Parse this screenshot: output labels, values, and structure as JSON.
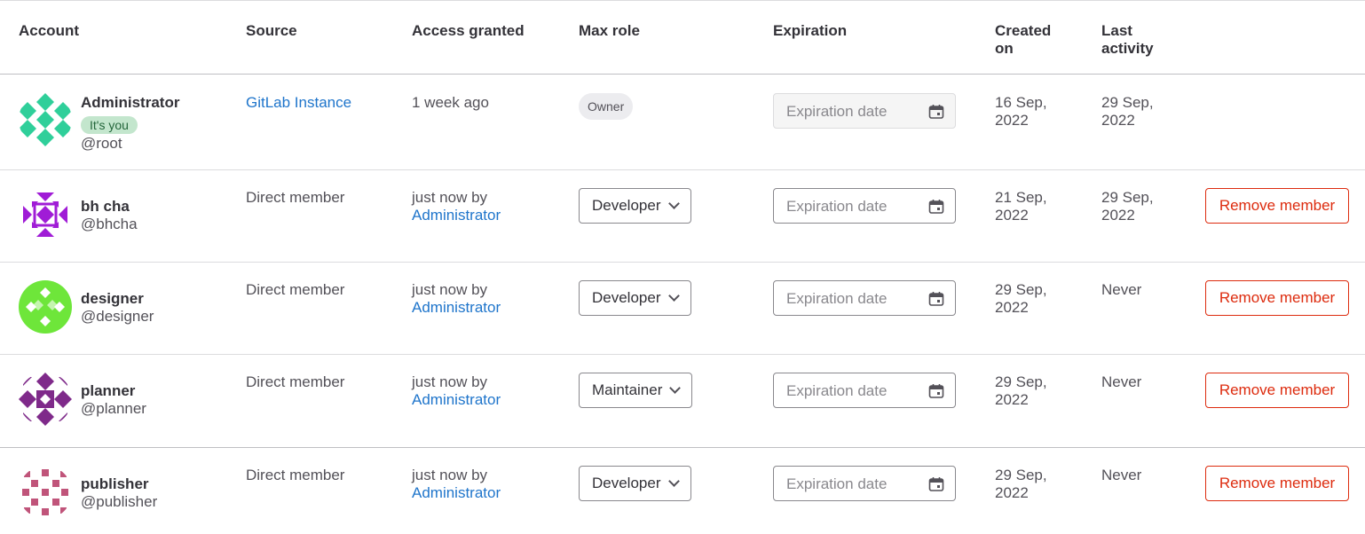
{
  "headers": {
    "account": "Account",
    "source": "Source",
    "access_granted": "Access granted",
    "max_role": "Max role",
    "expiration": "Expiration",
    "created_on_1": "Created",
    "created_on_2": "on",
    "last_activity_1": "Last",
    "last_activity_2": "activity"
  },
  "members": [
    {
      "name": "Administrator",
      "username": "@root",
      "badge": "It's you",
      "source": "GitLab Instance",
      "access_text": "1 week ago",
      "access_by": "",
      "role": "Owner",
      "expiration_placeholder": "Expiration date",
      "created_1": "16 Sep,",
      "created_2": "2022",
      "activity_1": "29 Sep,",
      "activity_2": "2022",
      "avatar_color": "#2fcf9a",
      "remove_label": ""
    },
    {
      "name": "bh cha",
      "username": "@bhcha",
      "source": "Direct member",
      "access_text": "just now by",
      "access_by": "Administrator",
      "role": "Developer",
      "expiration_placeholder": "Expiration date",
      "created_1": "21 Sep,",
      "created_2": "2022",
      "activity_1": "29 Sep,",
      "activity_2": "2022",
      "avatar_color": "#a01cd6",
      "remove_label": "Remove member"
    },
    {
      "name": "designer",
      "username": "@designer",
      "source": "Direct member",
      "access_text": "just now by",
      "access_by": "Administrator",
      "role": "Developer",
      "expiration_placeholder": "Expiration date",
      "created_1": "29 Sep,",
      "created_2": "2022",
      "activity_1": "Never",
      "activity_2": "",
      "avatar_color": "#6ee63a",
      "remove_label": "Remove member"
    },
    {
      "name": "planner",
      "username": "@planner",
      "source": "Direct member",
      "access_text": "just now by",
      "access_by": "Administrator",
      "role": "Maintainer",
      "expiration_placeholder": "Expiration date",
      "created_1": "29 Sep,",
      "created_2": "2022",
      "activity_1": "Never",
      "activity_2": "",
      "avatar_color": "#7f2a8a",
      "remove_label": "Remove member"
    },
    {
      "name": "publisher",
      "username": "@publisher",
      "source": "Direct member",
      "access_text": "just now by",
      "access_by": "Administrator",
      "role": "Developer",
      "expiration_placeholder": "Expiration date",
      "created_1": "29 Sep,",
      "created_2": "2022",
      "activity_1": "Never",
      "activity_2": "",
      "avatar_color": "#c0547a",
      "remove_label": "Remove member"
    }
  ],
  "icons": {
    "calendar": "calendar-icon",
    "chevron": "chevron-down-icon",
    "avatar": "identicon-avatar"
  },
  "colors": {
    "link": "#1f75cb",
    "danger": "#dd2b0e",
    "badge_bg": "#c3e6cd"
  }
}
